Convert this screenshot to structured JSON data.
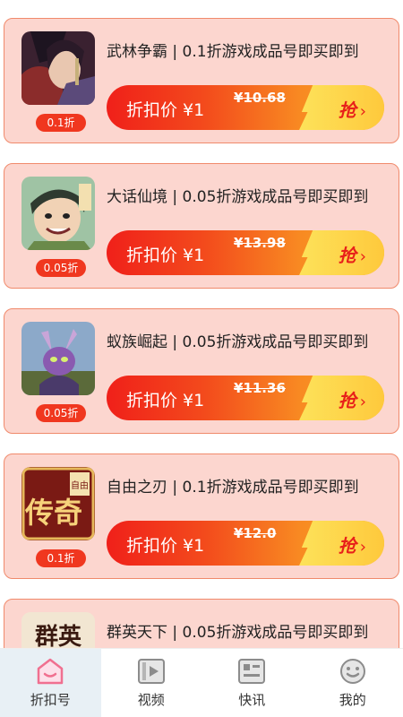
{
  "games": [
    {
      "title": "武林争霸 | 0.1折游戏成品号即买即到",
      "discount": "0.1折",
      "price_label": "折扣价 ¥1",
      "original_price": "¥10.68",
      "grab_label": "抢",
      "icon": "wulin-game-icon"
    },
    {
      "title": "大话仙境 | 0.05折游戏成品号即买即到",
      "discount": "0.05折",
      "price_label": "折扣价 ¥1",
      "original_price": "¥13.98",
      "grab_label": "抢",
      "icon": "dahua-game-icon"
    },
    {
      "title": "蚁族崛起 | 0.05折游戏成品号即买即到",
      "discount": "0.05折",
      "price_label": "折扣价 ¥1",
      "original_price": "¥11.36",
      "grab_label": "抢",
      "icon": "yizu-game-icon"
    },
    {
      "title": "自由之刃 | 0.1折游戏成品号即买即到",
      "discount": "0.1折",
      "price_label": "折扣价 ¥1",
      "original_price": "¥12.0",
      "grab_label": "抢",
      "icon": "ziyou-game-icon"
    },
    {
      "title": "群英天下 | 0.05折游戏成品号即买即到",
      "discount": "",
      "price_label": "",
      "original_price": "",
      "grab_label": "",
      "icon": "qunying-game-icon"
    }
  ],
  "tabbar": {
    "tabs": [
      {
        "label": "折扣号",
        "icon": "home-icon",
        "active": true
      },
      {
        "label": "视频",
        "icon": "video-icon",
        "active": false
      },
      {
        "label": "快讯",
        "icon": "news-icon",
        "active": false
      },
      {
        "label": "我的",
        "icon": "profile-icon",
        "active": false
      }
    ]
  },
  "colors": {
    "card_bg": "#fcd6cf",
    "card_border": "#f08a6c",
    "badge": "#f0371f",
    "accent": "#e8201a",
    "tab_active_icon": "#f07090"
  },
  "thumb_text": {
    "game3_glyph": "自由",
    "game3_glyph2": "传奇",
    "game4_glyph": "群英"
  }
}
